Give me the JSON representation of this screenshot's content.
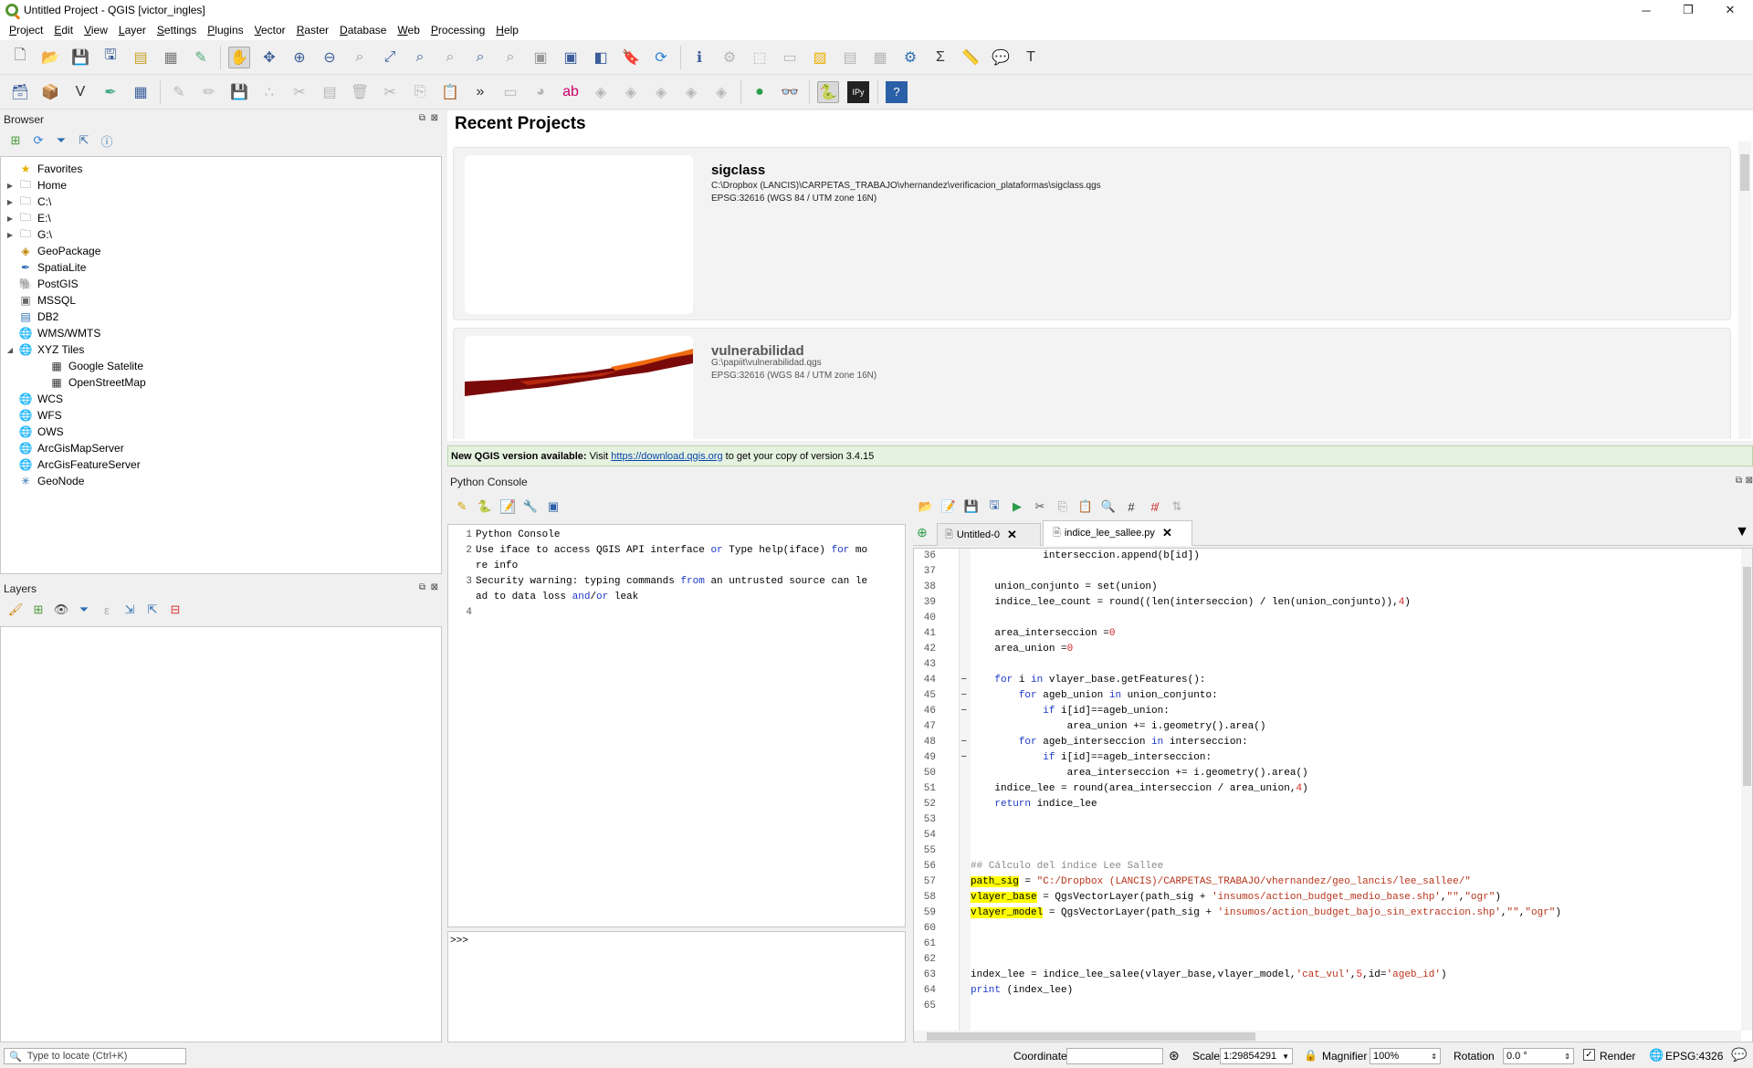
{
  "window": {
    "title": "Untitled Project - QGIS [victor_ingles]",
    "minimize": "─",
    "restore": "❐",
    "close": "✕"
  },
  "menu": [
    "Project",
    "Edit",
    "View",
    "Layer",
    "Settings",
    "Plugins",
    "Vector",
    "Raster",
    "Database",
    "Web",
    "Processing",
    "Help"
  ],
  "browser": {
    "title": "Browser",
    "items": [
      {
        "label": "Favorites",
        "icon": "star-icon",
        "arrow": ""
      },
      {
        "label": "Home",
        "icon": "folder-icon",
        "arrow": "▶"
      },
      {
        "label": "C:\\",
        "icon": "folder-icon",
        "arrow": "▶"
      },
      {
        "label": "E:\\",
        "icon": "folder-icon",
        "arrow": "▶"
      },
      {
        "label": "G:\\",
        "icon": "folder-icon",
        "arrow": "▶"
      },
      {
        "label": "GeoPackage",
        "icon": "geopackage-icon",
        "arrow": ""
      },
      {
        "label": "SpatiaLite",
        "icon": "spatialite-icon",
        "arrow": ""
      },
      {
        "label": "PostGIS",
        "icon": "postgis-icon",
        "arrow": ""
      },
      {
        "label": "MSSQL",
        "icon": "mssql-icon",
        "arrow": ""
      },
      {
        "label": "DB2",
        "icon": "db2-icon",
        "arrow": ""
      },
      {
        "label": "WMS/WMTS",
        "icon": "globe-icon",
        "arrow": ""
      },
      {
        "label": "XYZ Tiles",
        "icon": "globe-icon",
        "arrow": "◢"
      },
      {
        "label": "Google Satelite",
        "icon": "tiles-icon",
        "arrow": "",
        "indent": true
      },
      {
        "label": "OpenStreetMap",
        "icon": "tiles-icon",
        "arrow": "",
        "indent": true
      },
      {
        "label": "WCS",
        "icon": "globe-icon",
        "arrow": ""
      },
      {
        "label": "WFS",
        "icon": "globe-icon",
        "arrow": ""
      },
      {
        "label": "OWS",
        "icon": "globe-icon",
        "arrow": ""
      },
      {
        "label": "ArcGisMapServer",
        "icon": "globe-icon",
        "arrow": ""
      },
      {
        "label": "ArcGisFeatureServer",
        "icon": "globe-icon",
        "arrow": ""
      },
      {
        "label": "GeoNode",
        "icon": "geonode-icon",
        "arrow": ""
      }
    ]
  },
  "layers": {
    "title": "Layers"
  },
  "recent": {
    "title": "Recent Projects",
    "projects": [
      {
        "name": "sigclass",
        "path": "C:\\Dropbox (LANCIS)\\CARPETAS_TRABAJO\\vhernandez\\verificacion_plataformas\\sigclass.qgs",
        "crs": "EPSG:32616 (WGS 84 / UTM zone 16N)"
      },
      {
        "name": "vulnerabilidad",
        "path": "G:\\papiit\\vulnerabilidad.qgs",
        "crs": "EPSG:32616 (WGS 84 / UTM zone 16N)"
      }
    ]
  },
  "update_banner": {
    "bold": "New QGIS version available:",
    "pre": " Visit ",
    "link": "https://download.qgis.org",
    "post": " to get your copy of version 3.4.15"
  },
  "console": {
    "title": "Python Console",
    "prompt": ">>>",
    "output_lines": [
      {
        "n": "1",
        "text": "Python Console"
      },
      {
        "n": "2",
        "text": "Use iface to access QGIS API interface or Type help(iface) for mo"
      },
      {
        "n": "",
        "text": "re info"
      },
      {
        "n": "3",
        "text": "Security warning: typing commands from an untrusted source can le"
      },
      {
        "n": "",
        "text": "ad to data loss and/or leak"
      },
      {
        "n": "4",
        "text": ""
      }
    ]
  },
  "editor": {
    "tabs": [
      {
        "label": "Untitled-0",
        "active": false
      },
      {
        "label": "indice_lee_sallee.py",
        "active": true
      }
    ],
    "lines": [
      {
        "n": "36",
        "fold": "",
        "html": "            interseccion.append(b[id])"
      },
      {
        "n": "37",
        "fold": "",
        "html": ""
      },
      {
        "n": "38",
        "fold": "",
        "html": "    union_conjunto = set(union)"
      },
      {
        "n": "39",
        "fold": "",
        "html": "    indice_lee_count = round((len(interseccion) / len(union_conjunto)),4)"
      },
      {
        "n": "40",
        "fold": "",
        "html": ""
      },
      {
        "n": "41",
        "fold": "",
        "html": "    area_interseccion =0"
      },
      {
        "n": "42",
        "fold": "",
        "html": "    area_union =0"
      },
      {
        "n": "43",
        "fold": "",
        "html": ""
      },
      {
        "n": "44",
        "fold": "−",
        "html": "    for i in vlayer_base.getFeatures():"
      },
      {
        "n": "45",
        "fold": "−",
        "html": "        for ageb_union in union_conjunto:"
      },
      {
        "n": "46",
        "fold": "−",
        "html": "            if i[id]==ageb_union:"
      },
      {
        "n": "47",
        "fold": "",
        "html": "                area_union += i.geometry().area()"
      },
      {
        "n": "48",
        "fold": "−",
        "html": "        for ageb_interseccion in interseccion:"
      },
      {
        "n": "49",
        "fold": "−",
        "html": "            if i[id]==ageb_interseccion:"
      },
      {
        "n": "50",
        "fold": "",
        "html": "                area_interseccion += i.geometry().area()"
      },
      {
        "n": "51",
        "fold": "",
        "html": "    indice_lee = round(area_interseccion / area_union,4)"
      },
      {
        "n": "52",
        "fold": "",
        "html": "    return indice_lee"
      },
      {
        "n": "53",
        "fold": "",
        "html": ""
      },
      {
        "n": "54",
        "fold": "",
        "html": ""
      },
      {
        "n": "55",
        "fold": "",
        "html": ""
      },
      {
        "n": "56",
        "fold": "",
        "html": "## Cálculo del índice Lee Sallee"
      },
      {
        "n": "57",
        "fold": "",
        "html": "path_sig = \"C:/Dropbox (LANCIS)/CARPETAS_TRABAJO/vhernandez/geo_lancis/lee_sallee/\""
      },
      {
        "n": "58",
        "fold": "",
        "html": "vlayer_base = QgsVectorLayer(path_sig + 'insumos/action_budget_medio_base.shp',\"\",\"ogr\")"
      },
      {
        "n": "59",
        "fold": "",
        "html": "vlayer_model = QgsVectorLayer(path_sig + 'insumos/action_budget_bajo_sin_extraccion.shp',\"\",\"ogr\")"
      },
      {
        "n": "60",
        "fold": "",
        "html": ""
      },
      {
        "n": "61",
        "fold": "",
        "html": ""
      },
      {
        "n": "62",
        "fold": "",
        "html": ""
      },
      {
        "n": "63",
        "fold": "",
        "html": "index_lee = indice_lee_salee(vlayer_base,vlayer_model,'cat_vul',5,id='ageb_id')"
      },
      {
        "n": "64",
        "fold": "",
        "html": "print (index_lee)"
      },
      {
        "n": "65",
        "fold": "",
        "html": ""
      }
    ]
  },
  "status": {
    "locate_placeholder": "Type to locate (Ctrl+K)",
    "coordinate_label": "Coordinate",
    "coordinate_value": "",
    "scale_label": "Scale",
    "scale_value": "1:29854291",
    "magnifier_label": "Magnifier",
    "magnifier_value": "100%",
    "rotation_label": "Rotation",
    "rotation_value": "0.0 °",
    "render_label": "Render",
    "crs": "EPSG:4326"
  },
  "colors": {
    "accent_green": "#589632",
    "banner_bg": "#e6f2e0",
    "highlight": "#ffff00",
    "thumb_dark_red": "#7a0a0a",
    "thumb_orange": "#f06a10"
  }
}
